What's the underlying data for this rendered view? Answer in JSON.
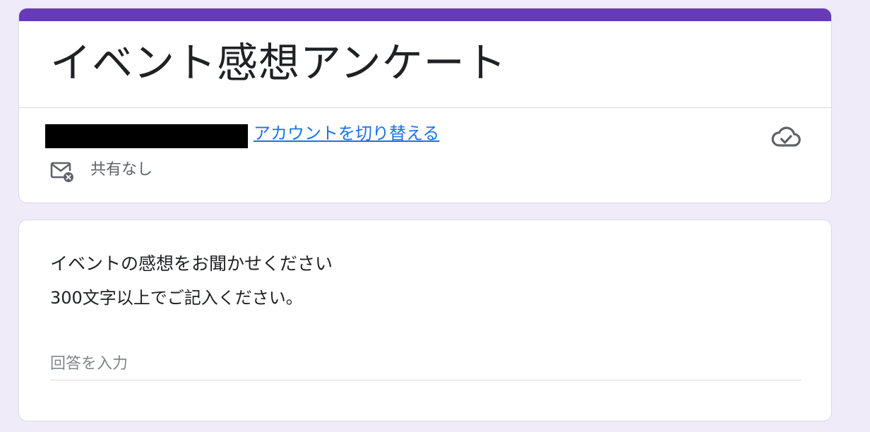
{
  "form": {
    "title": "イベント感想アンケート",
    "accent_color": "#673ab7",
    "background_color": "#f0ebf8"
  },
  "account": {
    "switch_account_label": "アカウントを切り替える",
    "sharing_status": "共有なし",
    "link_color": "#1a73e8"
  },
  "icons": {
    "save_status": "cloud-done-icon",
    "sharing": "mail-off-icon"
  },
  "question": {
    "title": "イベントの感想をお聞かせください",
    "description": "300文字以上でご記入ください。",
    "answer_value": "",
    "answer_placeholder": "回答を入力"
  }
}
